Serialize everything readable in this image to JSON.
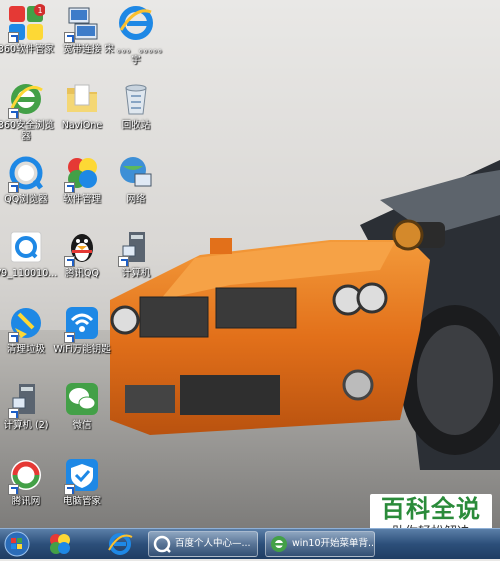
{
  "desktop": {
    "icons": [
      {
        "label": "360软件管家",
        "icon": "360-software-manager-icon",
        "badge": "1"
      },
      {
        "label": "宽带连接",
        "icon": "broadband-connection-icon"
      },
      {
        "label": "宋 。。。 。。。。。宇",
        "icon": "ie-browser-icon"
      },
      {
        "label": "360安全浏览器",
        "icon": "360-browser-icon"
      },
      {
        "label": "NaviOne",
        "icon": "folder-icon"
      },
      {
        "label": "回收站",
        "icon": "recycle-bin-icon"
      },
      {
        "label": "QQ浏览器",
        "icon": "qq-browser-icon"
      },
      {
        "label": "软件管理",
        "icon": "software-manager-icon"
      },
      {
        "label": "网络",
        "icon": "network-icon"
      },
      {
        "label": "V9_110010...",
        "icon": "qq-browser-installer-icon"
      },
      {
        "label": "腾讯QQ",
        "icon": "qq-penguin-icon"
      },
      {
        "label": "计算机",
        "icon": "computer-icon"
      },
      {
        "label": "清理垃圾",
        "icon": "clean-junk-icon"
      },
      {
        "label": "WiFi万能钥匙",
        "icon": "wifi-key-icon"
      },
      {
        "label": "计算机 (2)",
        "icon": "computer-2-icon"
      },
      {
        "label": "微信",
        "icon": "wechat-icon"
      },
      {
        "label": "腾讯网",
        "icon": "tencent-news-icon"
      },
      {
        "label": "电脑管家",
        "icon": "pc-manager-icon"
      }
    ]
  },
  "taskbar": {
    "tasks": [
      {
        "label": "百度个人中心—...",
        "icon": "baidu-icon"
      },
      {
        "label": "win10开始菜单背...",
        "icon": "360-browser-icon"
      }
    ]
  },
  "watermark": {
    "main": "百科全说",
    "sub": "助你轻松解决"
  },
  "colors": {
    "car_body": "#e8751c",
    "taskbar": "#2c4f7a",
    "watermark_green": "#2a8b3a"
  }
}
